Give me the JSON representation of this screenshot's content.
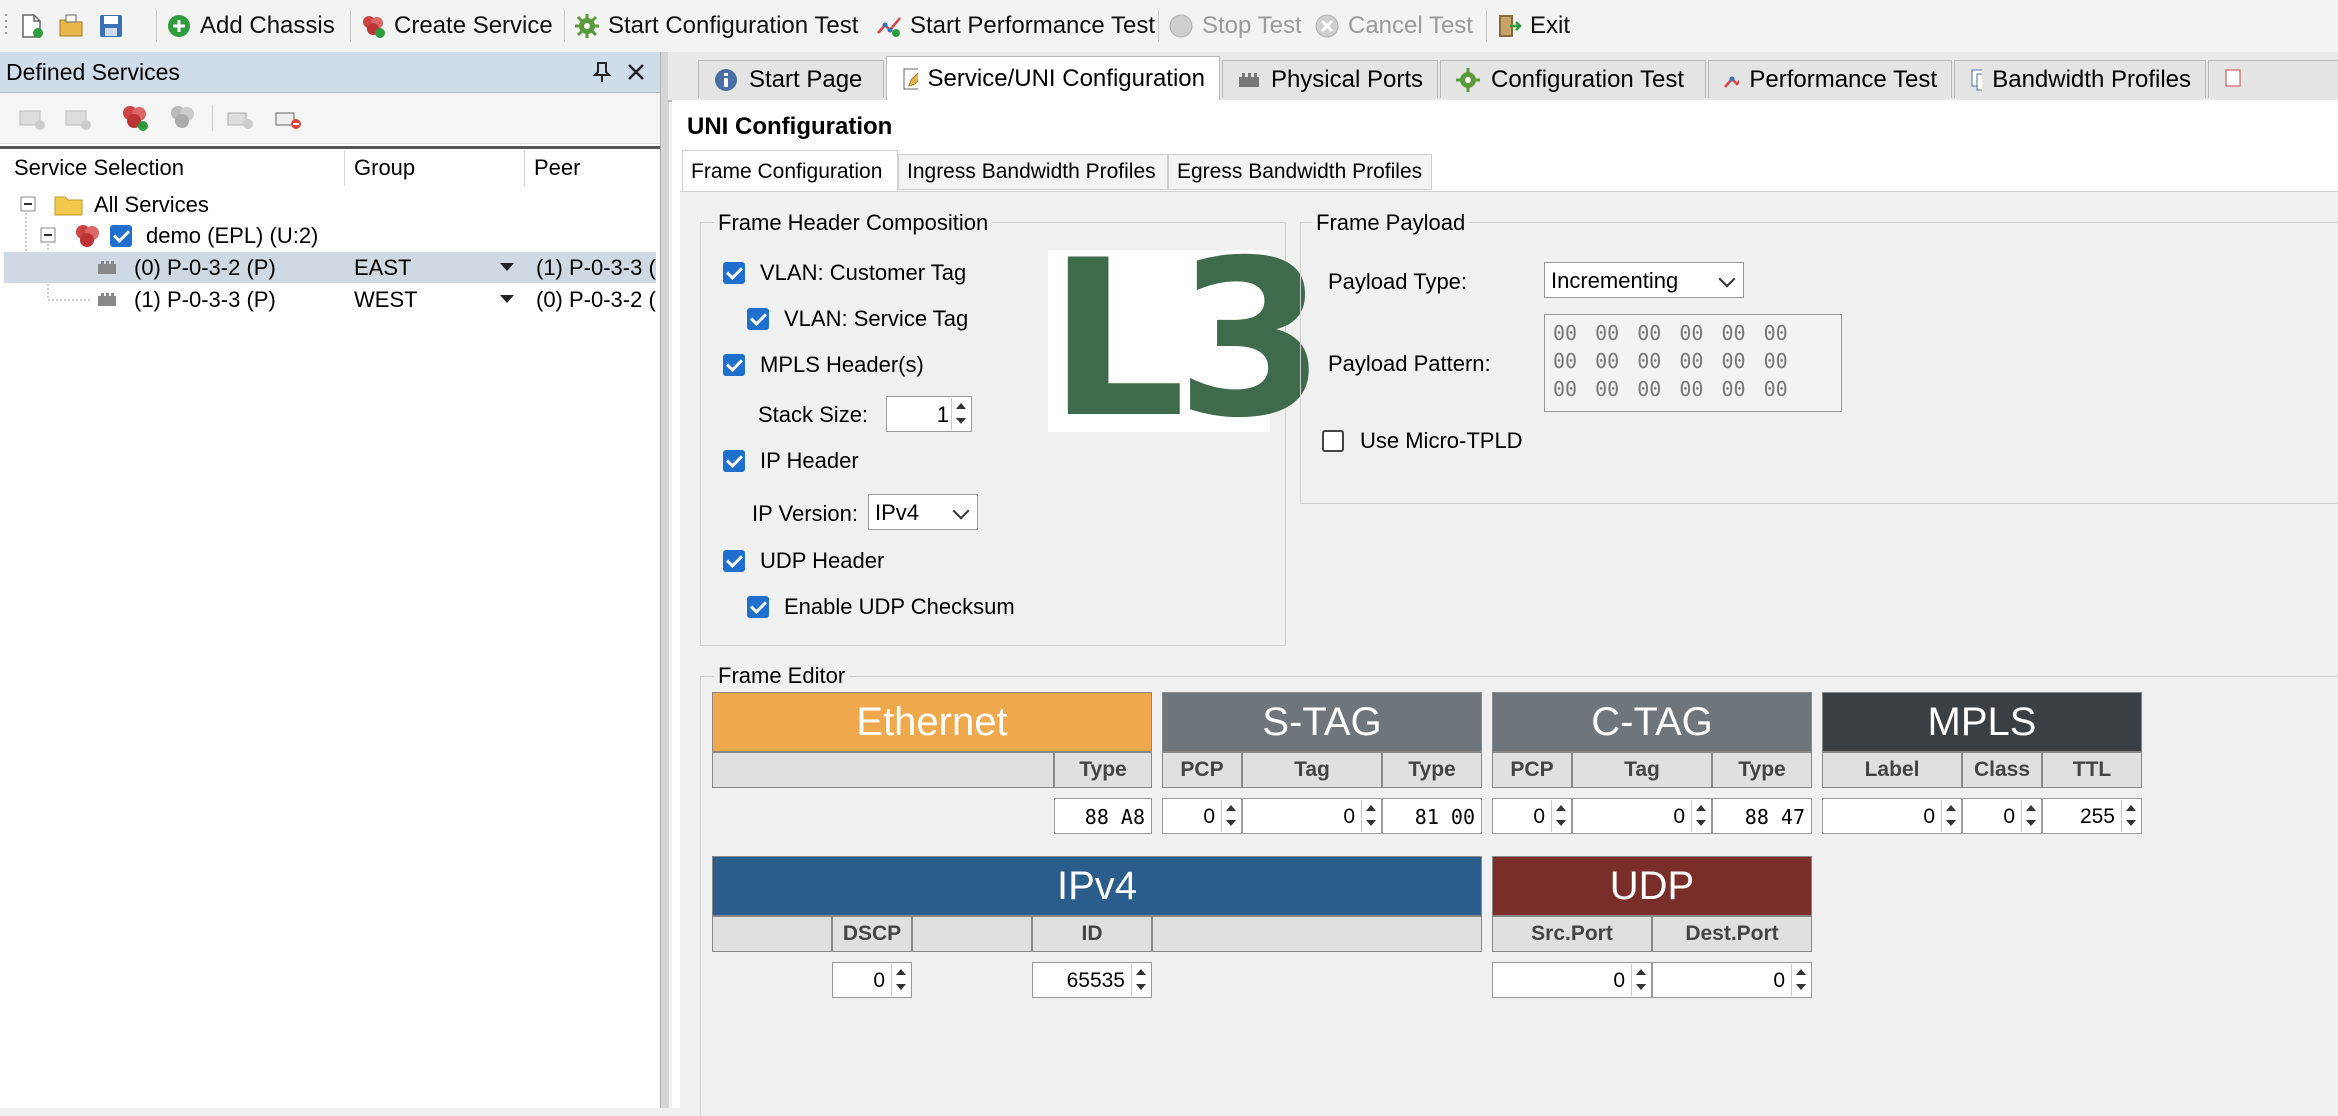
{
  "toolbar": {
    "add_chassis": "Add Chassis",
    "create_service": "Create Service",
    "start_config_test": "Start Configuration Test",
    "start_perf_test": "Start Performance Test",
    "stop_test": "Stop Test",
    "cancel_test": "Cancel Test",
    "exit": "Exit"
  },
  "left_panel": {
    "title": "Defined Services",
    "columns": [
      "Service Selection",
      "Group",
      "Peer"
    ],
    "tree": {
      "root": "All Services",
      "service": "demo (EPL) (U:2)",
      "rows": [
        {
          "name": "(0) P-0-3-2 (P)",
          "group": "EAST",
          "peer": "(1) P-0-3-3 ("
        },
        {
          "name": "(1) P-0-3-3 (P)",
          "group": "WEST",
          "peer": "(0) P-0-3-2 ("
        }
      ]
    }
  },
  "tabs": [
    "Start Page",
    "Service/UNI Configuration",
    "Physical Ports",
    "Configuration Test",
    "Performance Test",
    "Bandwidth Profiles"
  ],
  "uni": {
    "title": "UNI Configuration",
    "subtabs": [
      "Frame Configuration",
      "Ingress Bandwidth Profiles",
      "Egress Bandwidth Profiles"
    ],
    "frame_header": {
      "title": "Frame Header Composition",
      "vlan_customer": "VLAN: Customer Tag",
      "vlan_service": "VLAN: Service Tag",
      "mpls": "MPLS Header(s)",
      "stack_size_label": "Stack Size:",
      "stack_size": "1",
      "ip_header": "IP Header",
      "ip_version_label": "IP Version:",
      "ip_version": "IPv4",
      "udp_header": "UDP Header",
      "udp_checksum": "Enable UDP Checksum",
      "layer_badge": "L3"
    },
    "payload": {
      "title": "Frame Payload",
      "type_label": "Payload Type:",
      "type_value": "Incrementing",
      "pattern_label": "Payload Pattern:",
      "pattern_lines": [
        "00 00 00 00 00 00",
        "00 00 00 00 00 00",
        "00 00 00 00 00 00"
      ],
      "micro_tpld": "Use Micro-TPLD"
    },
    "frame_editor": {
      "title": "Frame Editor",
      "ethernet": {
        "name": "Ethernet",
        "type_label": "Type",
        "type": "88 A8",
        "color": "#f0a84c"
      },
      "stag": {
        "name": "S-TAG",
        "pcp_label": "PCP",
        "tag_label": "Tag",
        "type_label": "Type",
        "pcp": "0",
        "tag": "0",
        "type": "81 00",
        "color": "#6e767c"
      },
      "ctag": {
        "name": "C-TAG",
        "pcp_label": "PCP",
        "tag_label": "Tag",
        "type_label": "Type",
        "pcp": "0",
        "tag": "0",
        "type": "88 47",
        "color": "#6e767c"
      },
      "mpls": {
        "name": "MPLS",
        "label_label": "Label",
        "class_label": "Class",
        "ttl_label": "TTL",
        "label": "0",
        "class": "0",
        "ttl": "255",
        "color": "#3a3f44"
      },
      "ipv4": {
        "name": "IPv4",
        "dscp_label": "DSCP",
        "id_label": "ID",
        "dscp": "0",
        "id": "65535",
        "color": "#2b5d8c"
      },
      "udp": {
        "name": "UDP",
        "src_label": "Src.Port",
        "dst_label": "Dest.Port",
        "src": "0",
        "dst": "0",
        "color": "#7a2e2a"
      }
    }
  }
}
